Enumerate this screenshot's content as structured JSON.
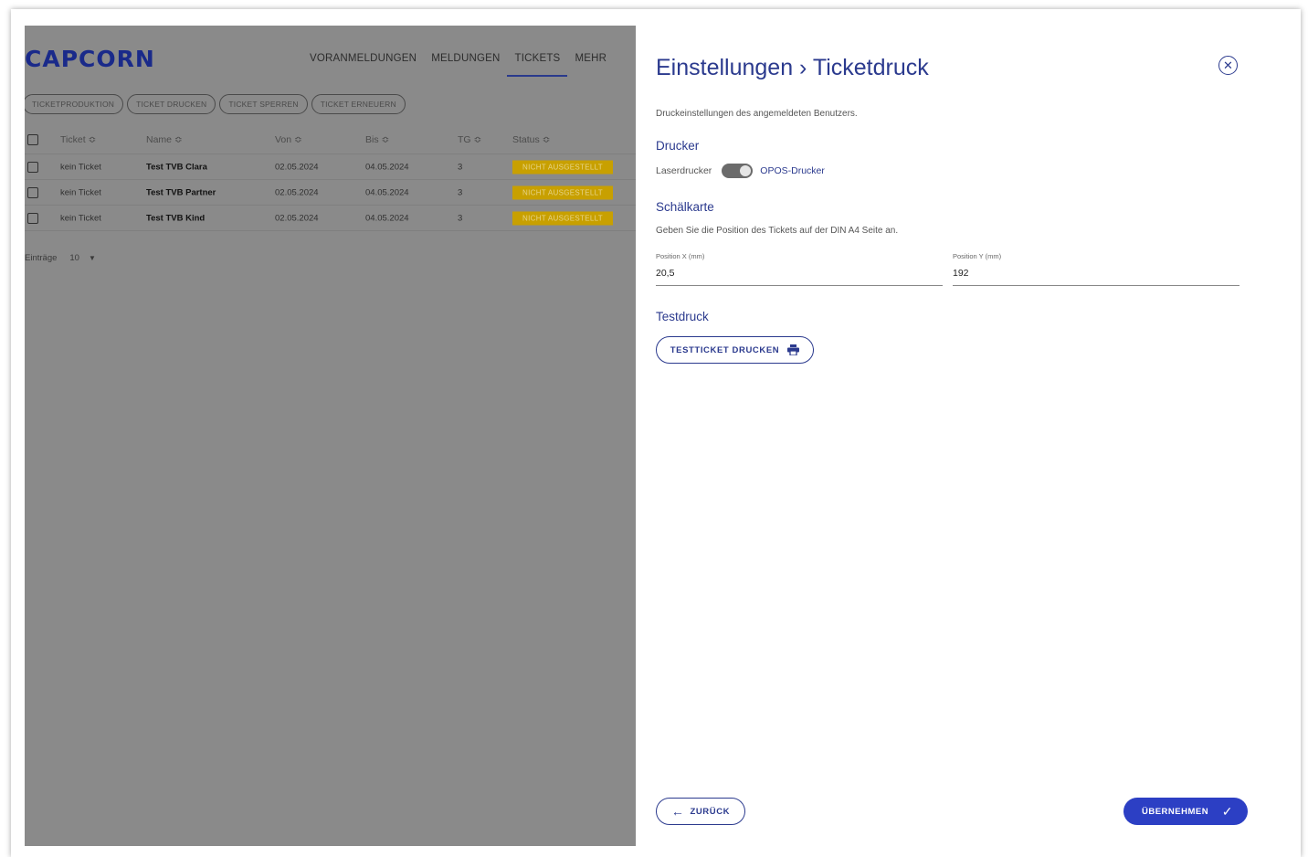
{
  "app": {
    "logo": "CAPCORN",
    "nav": [
      "VORANMELDUNGEN",
      "MELDUNGEN",
      "TICKETS",
      "MEHR"
    ],
    "nav_active": "TICKETS",
    "actions": [
      "TICKETPRODUKTION",
      "TICKET DRUCKEN",
      "TICKET SPERREN",
      "TICKET ERNEUERN"
    ],
    "table": {
      "headers": {
        "ticket": "Ticket ≎",
        "name": "Name ≎",
        "von": "Von ≎",
        "bis": "Bis ≎",
        "tg": "TG ≎",
        "status": "Status ≎"
      },
      "rows": [
        {
          "ticket": "kein Ticket",
          "name": "Test TVB Clara",
          "von": "02.05.2024",
          "bis": "04.05.2024",
          "tg": "3",
          "status": "NICHT AUSGESTELLT"
        },
        {
          "ticket": "kein Ticket",
          "name": "Test TVB Partner",
          "von": "02.05.2024",
          "bis": "04.05.2024",
          "tg": "3",
          "status": "NICHT AUSGESTELLT"
        },
        {
          "ticket": "kein Ticket",
          "name": "Test TVB Kind",
          "von": "02.05.2024",
          "bis": "04.05.2024",
          "tg": "3",
          "status": "NICHT AUSGESTELLT"
        }
      ]
    },
    "entries_label": "Einträge",
    "entries_value": "10",
    "status_color": "#c8a000"
  },
  "panel": {
    "title": "Einstellungen › Ticketdruck",
    "intro": "Druckeinstellungen des angemeldeten Benutzers.",
    "printer": {
      "heading": "Drucker",
      "left_label": "Laserdrucker",
      "right_label": "OPOS-Drucker"
    },
    "peelcard": {
      "heading": "Schälkarte",
      "description": "Geben Sie die Position des Tickets auf der DIN A4 Seite an.",
      "x_label": "Position X (mm)",
      "x_value": "20,5",
      "y_label": "Position Y (mm)",
      "y_value": "192"
    },
    "testprint": {
      "heading": "Testdruck",
      "button": "TESTTICKET DRUCKEN"
    },
    "back_button": "ZURÜCK",
    "apply_button": "ÜBERNEHMEN",
    "accent_color": "#2b3a8e",
    "primary_color": "#2c3fc4"
  }
}
